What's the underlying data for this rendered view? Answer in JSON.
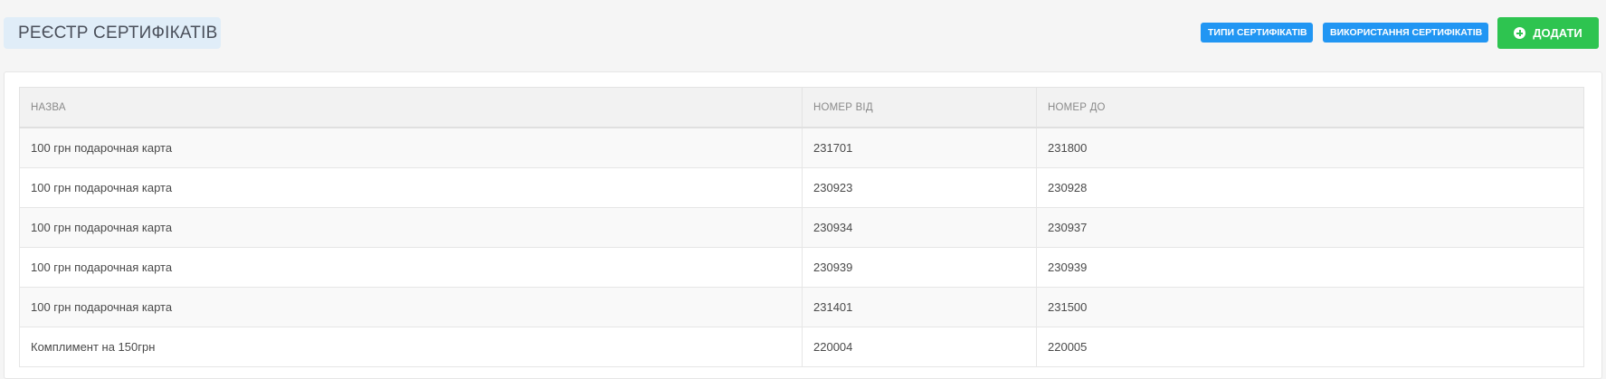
{
  "header": {
    "title": "РЕЄСТР СЕРТИФІКАТІВ",
    "types_button": "ТИПИ СЕРТИФІКАТІВ",
    "usage_button": "ВИКОРИСТАННЯ СЕРТИФІКАТІВ",
    "add_button": "ДОДАТИ",
    "add_icon": "plus-circle-icon"
  },
  "colors": {
    "primary_blue": "#2196f3",
    "success_green": "#2ec450",
    "title_bg": "#e0edf8"
  },
  "table": {
    "columns": [
      "НАЗВА",
      "НОМЕР ВІД",
      "НОМЕР ДО"
    ],
    "rows": [
      [
        "100 грн подарочная карта",
        "231701",
        "231800"
      ],
      [
        "100 грн подарочная карта",
        "230923",
        "230928"
      ],
      [
        "100 грн подарочная карта",
        "230934",
        "230937"
      ],
      [
        "100 грн подарочная карта",
        "230939",
        "230939"
      ],
      [
        "100 грн подарочная карта",
        "231401",
        "231500"
      ],
      [
        "Комплимент на 150грн",
        "220004",
        "220005"
      ]
    ]
  }
}
